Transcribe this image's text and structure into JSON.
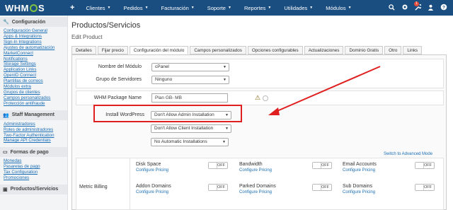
{
  "topbar": {
    "logo_pre": "WHM",
    "logo_post": "S",
    "menu": [
      "Clientes",
      "Pedidos",
      "Facturación",
      "Soporte",
      "Reportes",
      "Utilidades",
      "Módulos"
    ],
    "notification_count": "1"
  },
  "sidebar": {
    "sections": [
      {
        "title": "Configuración",
        "links": [
          "Configuración General",
          "Apps & Integrations",
          "Sign-In Integrations",
          "Ajustes de automatización",
          "MarketConnect",
          "Notifications",
          "Storage Settings",
          "Application Links",
          "OpenID Connect",
          "Plantillas de correos",
          "Módulos extra",
          "Grupos de clientes",
          "Campos personalizados",
          "Protección antifraude"
        ]
      },
      {
        "title": "Staff Management",
        "links": [
          "Administradores",
          "Roles de administradores",
          "Two-Factor Authentication",
          "Manage API Credentials"
        ]
      },
      {
        "title": "Formas de pago",
        "links": [
          "Monedas",
          "Pasarelas de pago",
          "Tax Configuration",
          "Promociones"
        ]
      },
      {
        "title": "Productos/Servicios",
        "links": []
      }
    ]
  },
  "page": {
    "title": "Productos/Servicios",
    "subtitle": "Edit Product",
    "tabs": [
      "Detalles",
      "Fijar precio",
      "Configuración del módulo",
      "Campos personalizados",
      "Opciones configurables",
      "Actualizaciones",
      "Dominio Gratis",
      "Otro",
      "Links"
    ],
    "active_tab": "Configuración del módulo"
  },
  "form": {
    "module_label": "Nombre del Módulo",
    "module_value": "cPanel",
    "server_group_label": "Grupo de Servidores",
    "server_group_value": "Ninguno",
    "package_label": "WHM Package Name",
    "package_value": "Plan   GB-       MB",
    "wordpress_label": "Install WordPress",
    "wordpress_admin": "Don't Allow Admin Installation",
    "wordpress_client": "Don't Allow Client Installation",
    "wordpress_auto": "No Automatic Installations",
    "advanced_link": "Switch to Advanced Mode",
    "metric_label": "Metric Billing",
    "configure_pricing": "Configure Pricing",
    "toggle_off": "OFF",
    "metrics": [
      "Disk Space",
      "Bandwidth",
      "Email Accounts",
      "Addon Domains",
      "Parked Domains",
      "Sub Domains"
    ]
  },
  "colors": {
    "navbar": "#1a4d80",
    "accent_red": "#e02020",
    "link": "#1a6eb5"
  }
}
